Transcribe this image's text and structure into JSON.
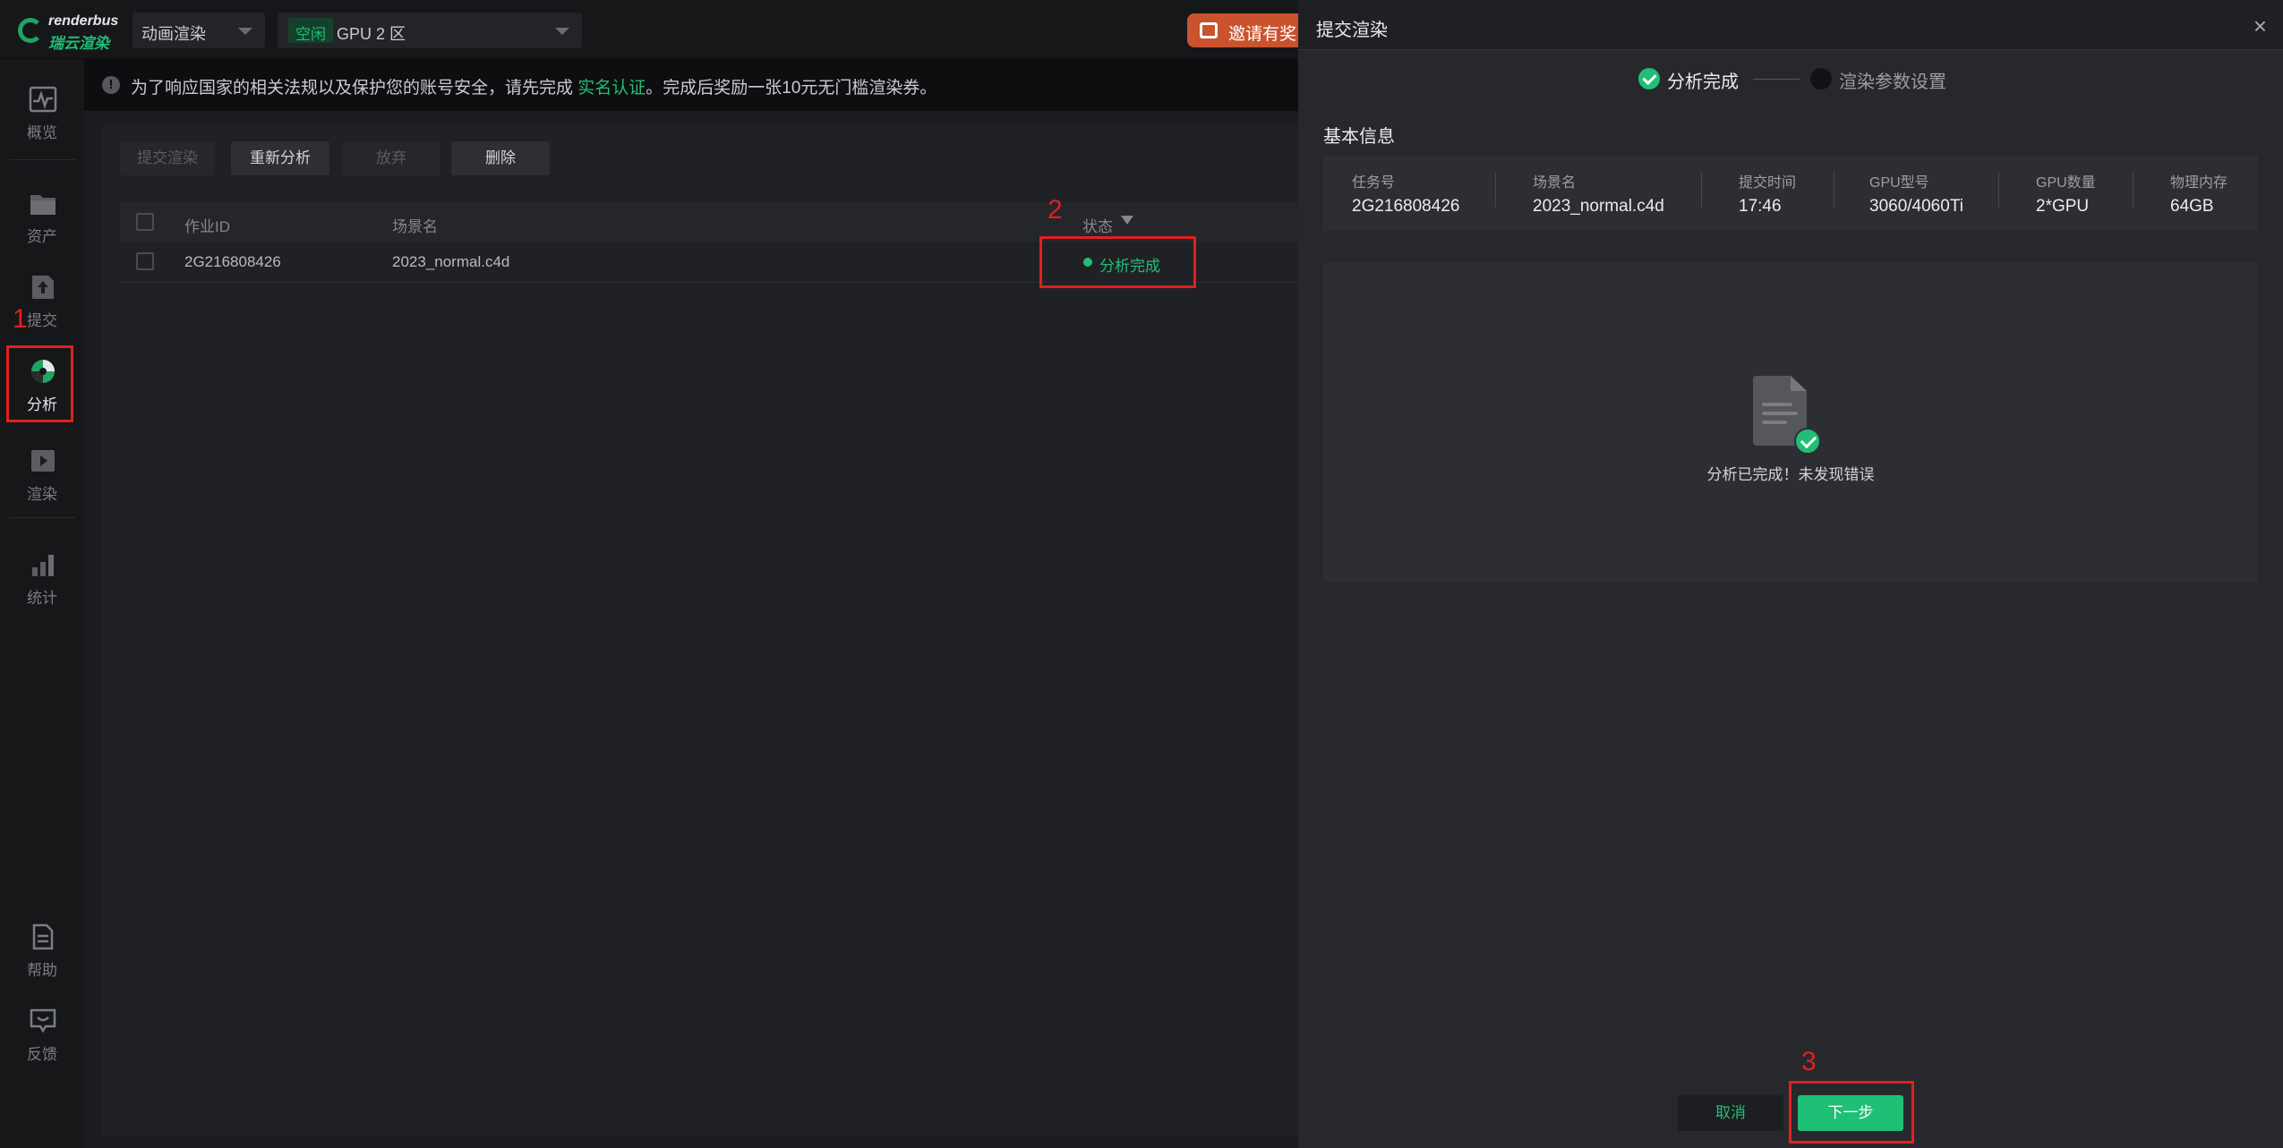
{
  "topbar": {
    "logo_en": "renderbus",
    "logo_cn": "瑞云渲染",
    "render_mode": "动画渲染",
    "gpu_tag": "空闲",
    "gpu_zone": "GPU 2 区",
    "invite_label": "邀请有奖"
  },
  "sidebar": {
    "items": [
      {
        "label": "概览",
        "icon": "overview-icon"
      },
      {
        "label": "资产",
        "icon": "asset-folder-icon"
      },
      {
        "label": "提交",
        "icon": "upload-icon"
      },
      {
        "label": "分析",
        "icon": "analyze-icon"
      },
      {
        "label": "渲染",
        "icon": "render-play-icon"
      },
      {
        "label": "统计",
        "icon": "bar-chart-icon"
      },
      {
        "label": "帮助",
        "icon": "help-document-icon"
      },
      {
        "label": "反馈",
        "icon": "feedback-icon"
      }
    ],
    "active": "分析"
  },
  "notice": {
    "prefix": "为了响应国家的相关法规以及保护您的账号安全，请先完成 ",
    "link": "实名认证",
    "suffix": "。完成后奖励一张10元无门槛渲染券。"
  },
  "toolbar": {
    "submit_render": "提交渲染",
    "reanalyze": "重新分析",
    "abandon": "放弃",
    "delete": "删除"
  },
  "table": {
    "columns": [
      "作业ID",
      "场景名",
      "状态"
    ],
    "rows": [
      {
        "job_id": "2G216808426",
        "scene": "2023_normal.c4d",
        "status": "分析完成"
      }
    ]
  },
  "annotations": [
    "1",
    "2",
    "3"
  ],
  "drawer": {
    "title": "提交渲染",
    "close": "×",
    "steps": [
      "分析完成",
      "渲染参数设置"
    ],
    "section_title": "基本信息",
    "info": [
      {
        "label": "任务号",
        "value": "2G216808426"
      },
      {
        "label": "场景名",
        "value": "2023_normal.c4d"
      },
      {
        "label": "提交时间",
        "value": "17:46"
      },
      {
        "label": "GPU型号",
        "value": "3060/4060Ti"
      },
      {
        "label": "GPU数量",
        "value": "2*GPU"
      },
      {
        "label": "物理内存",
        "value": "64GB"
      }
    ],
    "result_text": "分析已完成！未发现错误",
    "cancel": "取消",
    "next": "下一步"
  },
  "colors": {
    "accent": "#1fbf75",
    "annotation": "#e02020",
    "invite": "#c9532e"
  }
}
